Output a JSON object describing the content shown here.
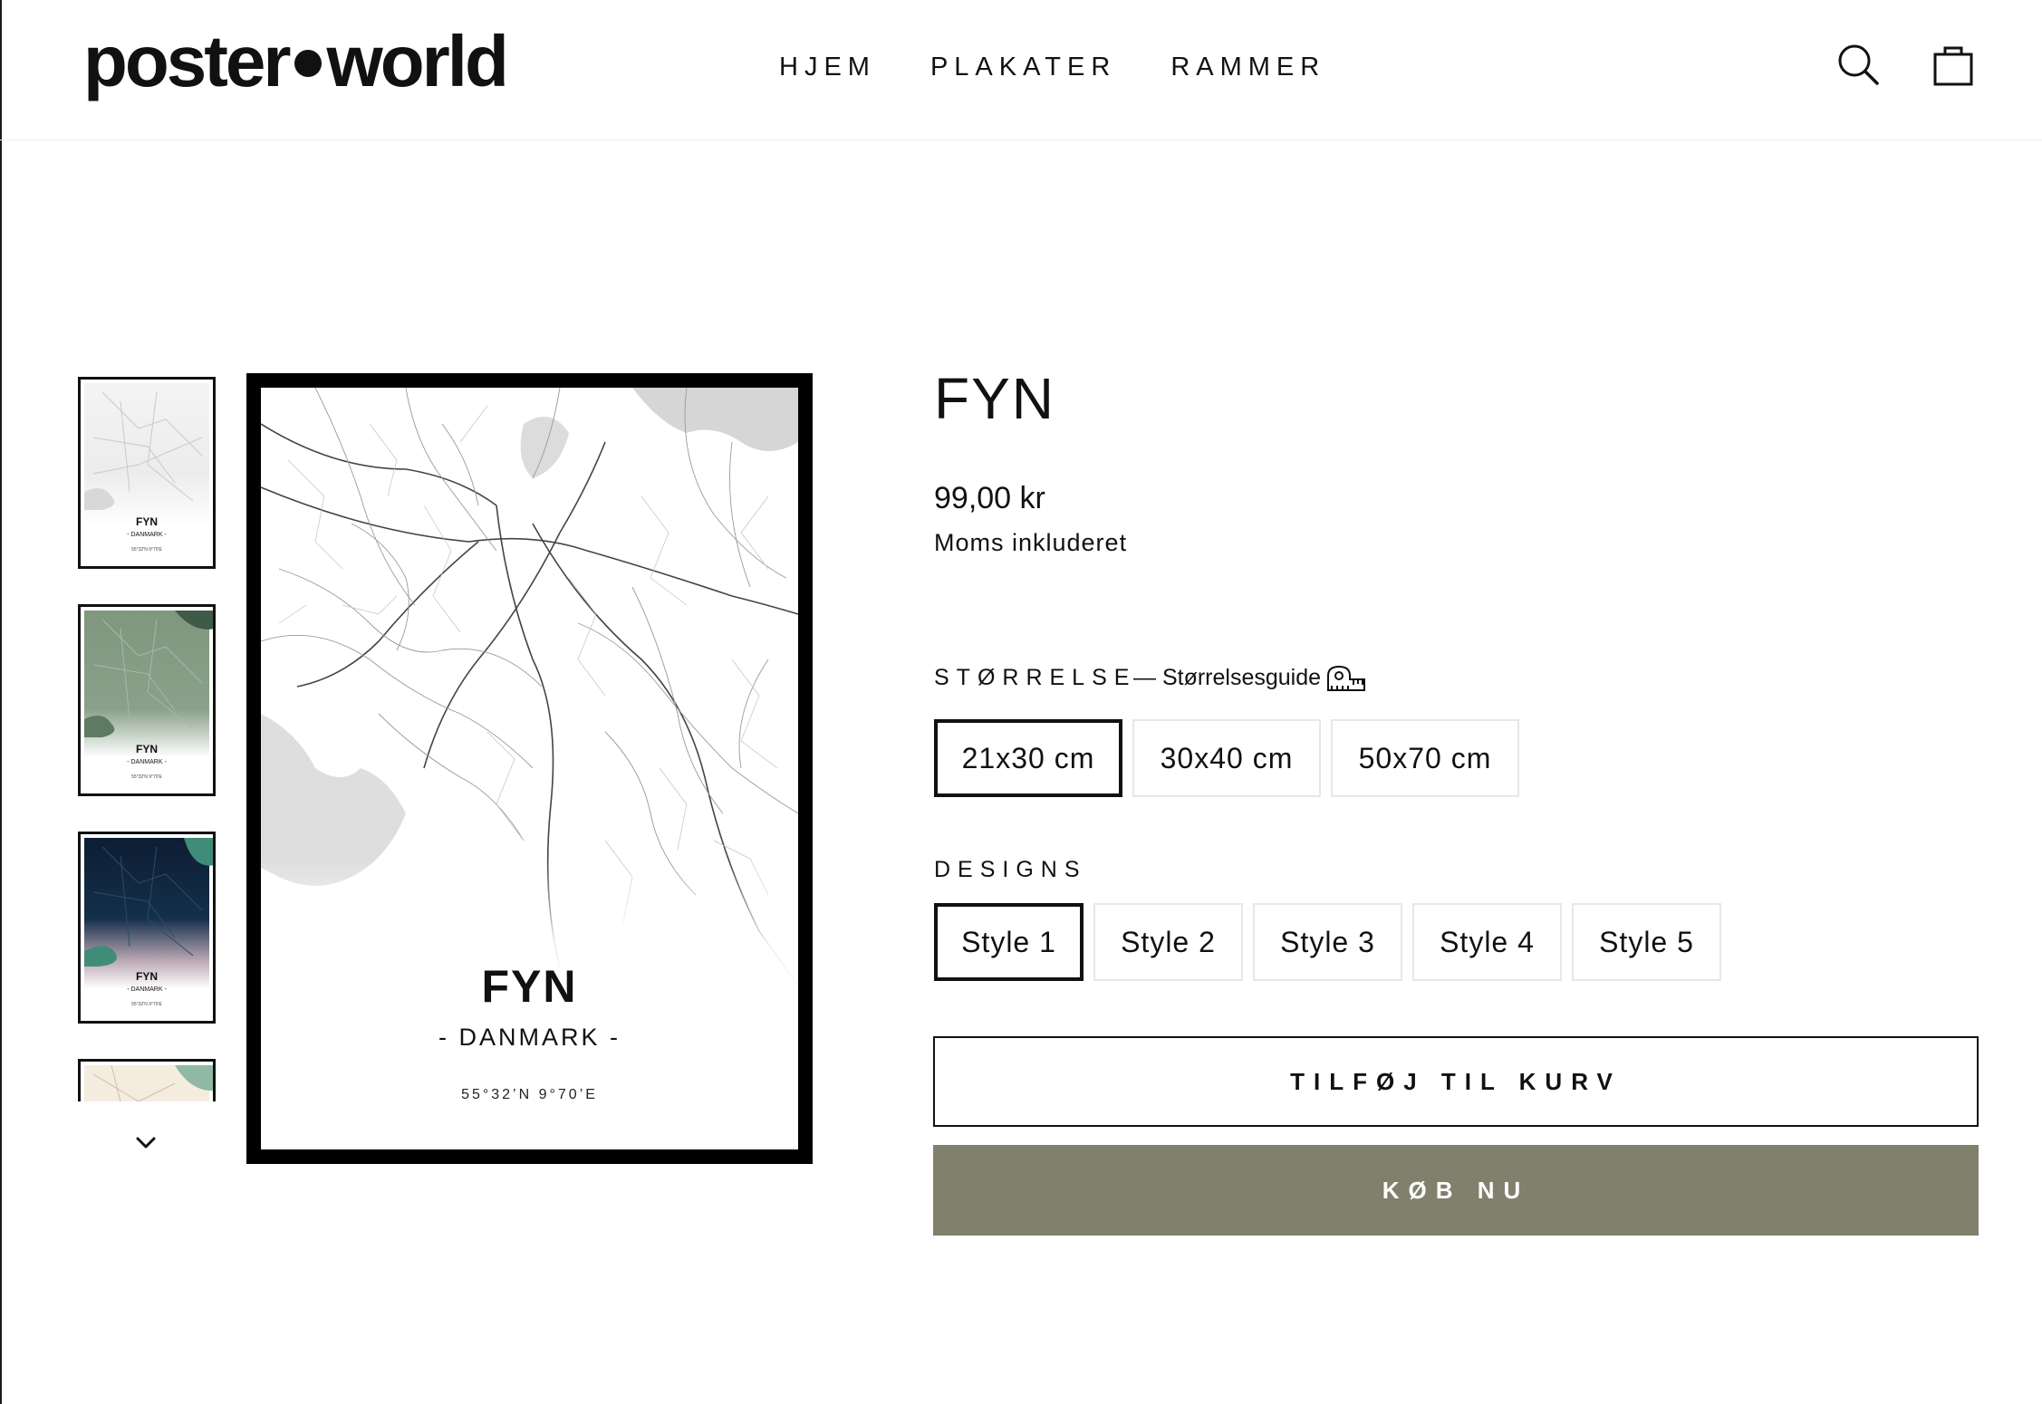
{
  "header": {
    "logo_left": "poster",
    "logo_right": "world",
    "nav": [
      "HJEM",
      "PLAKATER",
      "RAMMER"
    ],
    "icons": {
      "search": "search-icon",
      "cart": "shopping-bag-icon"
    }
  },
  "gallery": {
    "thumbnails": [
      {
        "name": "FYN",
        "country": "- DANMARK -",
        "coord": "55°32'N 9°70'E",
        "style": "white"
      },
      {
        "name": "FYN",
        "country": "- DANMARK -",
        "coord": "55°32'N 9°70'E",
        "style": "sage"
      },
      {
        "name": "FYN",
        "country": "- DANMARK -",
        "coord": "55°32'N 9°70'E",
        "style": "navy"
      },
      {
        "style": "beige"
      }
    ],
    "next_icon": "chevron-down-icon"
  },
  "poster": {
    "name": "FYN",
    "country": "- DANMARK -",
    "coord": "55°32’N 9°70’E"
  },
  "product": {
    "title": "FYN",
    "price": "99,00 kr",
    "vat_note": "Moms inkluderet",
    "size_label": "STØRRELSE",
    "size_guide": "— Størrelsesguide",
    "size_guide_icon": "ruler-tape-icon",
    "sizes": [
      "21x30 cm",
      "30x40 cm",
      "50x70 cm"
    ],
    "selected_size": "21x30 cm",
    "design_label": "DESIGNS",
    "designs": [
      "Style 1",
      "Style 2",
      "Style 3",
      "Style 4",
      "Style 5"
    ],
    "selected_design": "Style 1",
    "add_to_cart": "TILFØJ TIL KURV",
    "buy_now": "KØB NU"
  },
  "colors": {
    "buy_now_bg": "#80806c",
    "text": "#111111",
    "option_border": "#e7e7e7"
  }
}
